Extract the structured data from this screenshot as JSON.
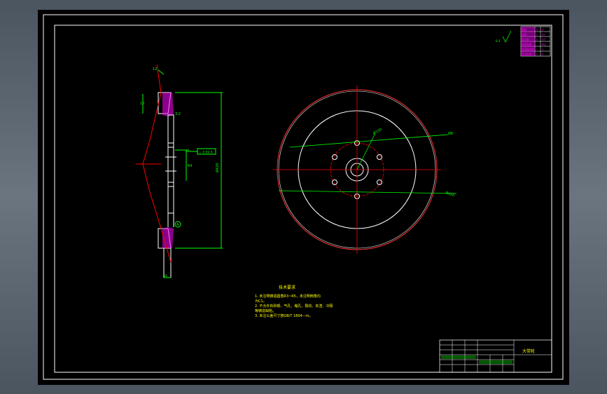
{
  "drawing": {
    "background": "#000000",
    "line_color": "#ffffff",
    "dimension_color": "#00ff00",
    "centerline_color": "#ff0000",
    "hatch_color": "#ff00ff",
    "text_color": "#ffff00"
  },
  "section_view": {
    "dim_height": "Ø420",
    "dim_thickness": "10",
    "dim_angle": "12",
    "datum_label": "A",
    "roughness_label": "3.2",
    "dim_hub": "64",
    "tolerance_frame": "⊥ 0.04 A"
  },
  "front_view": {
    "dim_hole_circle": "Ø150",
    "dim_outer": "Ø420",
    "dim_bore": "Ø8"
  },
  "technical_notes": {
    "title": "技术要求",
    "lines": [
      "1. 未注明铸造圆角R3~R5，未注明倒角均",
      "   为C1。",
      "2. 不允许有砂眼、气孔、缩孔、裂纹、夹渣、冷隔",
      "   等铸造缺陷。",
      "3. 未注公差尺寸按GB/T 1804—m。"
    ]
  },
  "corner_table": {
    "rows": [
      [
        "模数",
        "m",
        "4"
      ],
      [
        "齿数",
        "z",
        "52"
      ],
      [
        "压力角",
        "α",
        "20°"
      ],
      [
        "精度等级",
        "",
        "8GJ"
      ],
      [
        "齿顶高系数",
        "",
        "1"
      ],
      [
        "变位系数",
        "x",
        "0"
      ]
    ],
    "roughness_symbol": "6.3"
  },
  "title_block": {
    "drawing_name": "大带轮"
  }
}
